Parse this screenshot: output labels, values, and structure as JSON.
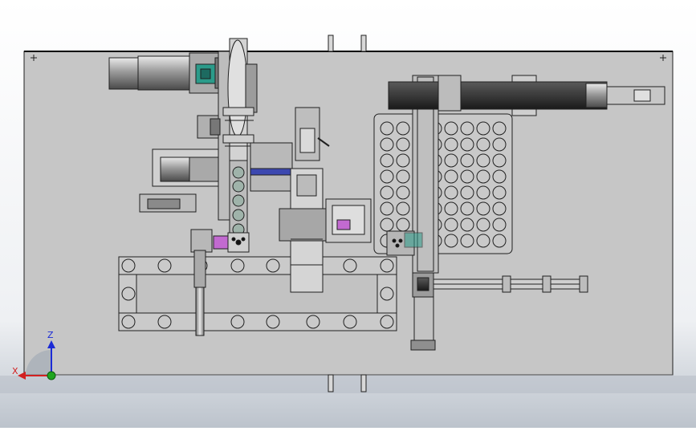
{
  "scene": {
    "background_top": "#ffffff",
    "background_bottom": "#bcc3cc",
    "plate_color": "#c6c6c6",
    "line_color": "#202020",
    "accent_teal": "#2b9b8a",
    "accent_pink": "#c26ad0",
    "accent_blue": "#3c48b0"
  },
  "axes": {
    "z_label": "Z",
    "x_label": "X",
    "z_color": "#1b2bd6",
    "x_color": "#d22020",
    "y_color": "#1fa51f"
  },
  "tray": {
    "rows": 7,
    "cols": 8
  },
  "icons": {
    "axis_triad": "axis-triad-icon"
  }
}
